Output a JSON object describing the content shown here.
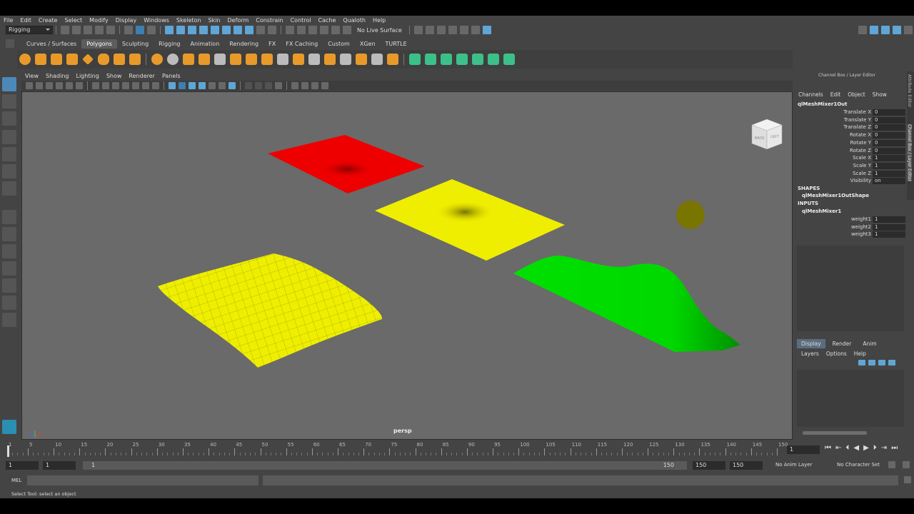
{
  "menubar": {
    "items": [
      "File",
      "Edit",
      "Create",
      "Select",
      "Modify",
      "Display",
      "Windows",
      "Skeleton",
      "Skin",
      "Deform",
      "Constrain",
      "Control",
      "Cache",
      "Qualoth",
      "Help"
    ]
  },
  "status": {
    "mode": "Rigging",
    "live_surface": "No Live Surface"
  },
  "shelf_tabs": [
    {
      "label": "Curves / Surfaces",
      "active": false
    },
    {
      "label": "Polygons",
      "active": true
    },
    {
      "label": "Sculpting",
      "active": false
    },
    {
      "label": "Rigging",
      "active": false
    },
    {
      "label": "Animation",
      "active": false
    },
    {
      "label": "Rendering",
      "active": false
    },
    {
      "label": "FX",
      "active": false
    },
    {
      "label": "FX Caching",
      "active": false
    },
    {
      "label": "Custom",
      "active": false
    },
    {
      "label": "XGen",
      "active": false
    },
    {
      "label": "TURTLE",
      "active": false
    }
  ],
  "viewport": {
    "menu": [
      "View",
      "Shading",
      "Lighting",
      "Show",
      "Renderer",
      "Panels"
    ],
    "camera_label": "persp",
    "viewcube": {
      "back": "BACK",
      "left": "LEFT"
    }
  },
  "channel_box": {
    "title": "Channel Box / Layer Editor",
    "menu": [
      "Channels",
      "Edit",
      "Object",
      "Show"
    ],
    "object": "qlMeshMixer1Out",
    "attributes": [
      {
        "name": "Translate X",
        "value": "0"
      },
      {
        "name": "Translate Y",
        "value": "0"
      },
      {
        "name": "Translate Z",
        "value": "0"
      },
      {
        "name": "Rotate X",
        "value": "0"
      },
      {
        "name": "Rotate Y",
        "value": "0"
      },
      {
        "name": "Rotate Z",
        "value": "0"
      },
      {
        "name": "Scale X",
        "value": "1"
      },
      {
        "name": "Scale Y",
        "value": "1"
      },
      {
        "name": "Scale Z",
        "value": "1"
      },
      {
        "name": "Visibility",
        "value": "on"
      }
    ],
    "shapes_header": "SHAPES",
    "shape": "qlMeshMixer1OutShape",
    "inputs_header": "INPUTS",
    "input": "qlMeshMixer1",
    "input_attributes": [
      {
        "name": "weight1",
        "value": "1"
      },
      {
        "name": "weight2",
        "value": "1"
      },
      {
        "name": "weight3",
        "value": "1"
      }
    ]
  },
  "side_tabs": {
    "attribute_editor": "Attribute Editor",
    "channel_box": "Channel Box / Layer Editor"
  },
  "layer_editor": {
    "tabs": [
      "Display",
      "Render",
      "Anim"
    ],
    "menu": [
      "Layers",
      "Options",
      "Help"
    ]
  },
  "timeline": {
    "ticks": [
      "1",
      "5",
      "10",
      "15",
      "20",
      "25",
      "30",
      "35",
      "40",
      "45",
      "50",
      "55",
      "60",
      "65",
      "70",
      "75",
      "80",
      "85",
      "90",
      "95",
      "100",
      "105",
      "110",
      "115",
      "120",
      "125",
      "130",
      "135",
      "140",
      "145",
      "150"
    ],
    "current_frame": "1"
  },
  "range": {
    "start": "1",
    "playback_start": "1",
    "slider_start": "1",
    "slider_end": "150",
    "playback_end": "150",
    "end": "150",
    "anim_layer": "No Anim Layer",
    "character_set": "No Character Set"
  },
  "command_line": {
    "label": "MEL"
  },
  "help_line": "Select Tool: select an object",
  "colors": {
    "red_plane": "#ee0000",
    "yellow_plane": "#f0ee00",
    "green_plane": "#00e000",
    "viewport_bg": "#6a6a6a"
  }
}
